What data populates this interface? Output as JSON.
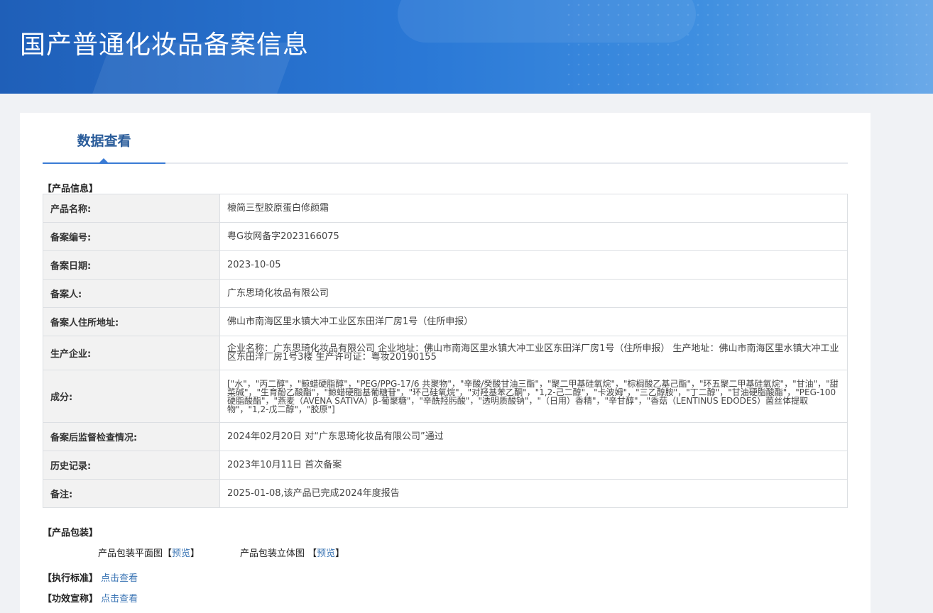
{
  "header": {
    "title": "国产普通化妆品备案信息"
  },
  "tab": {
    "label": "数据查看"
  },
  "product_section": {
    "title": "【产品信息】",
    "rows": [
      {
        "label": "产品名称:",
        "value": "榱简三型胶原蛋白修颜霜"
      },
      {
        "label": "备案编号:",
        "value": "粤G妆网备字2023166075"
      },
      {
        "label": "备案日期:",
        "value": "2023-10-05"
      },
      {
        "label": "备案人:",
        "value": "广东思琦化妆品有限公司"
      },
      {
        "label": "备案人住所地址:",
        "value": "佛山市南海区里水镇大冲工业区东田洋厂房1号（住所申报）"
      },
      {
        "label": "生产企业:",
        "value": "企业名称：广东思琦化妆品有限公司 企业地址：佛山市南海区里水镇大冲工业区东田洋厂房1号（住所申报） 生产地址：佛山市南海区里水镇大冲工业区东田洋厂房1号3楼 生产许可证：粤妆20190155"
      },
      {
        "label": "成分:",
        "value": "[\"水\"，\"丙二醇\"，\"鲸蜡硬脂醇\"，\"PEG/PPG-17/6 共聚物\"，\"辛酸/癸酸甘油三酯\"，\"聚二甲基硅氧烷\"，\"棕榈酸乙基己酯\"，\"环五聚二甲基硅氧烷\"，\"甘油\"，\"甜菜碱\"，\"生育酚乙酸酯\"，\"鲸蜡硬脂基葡糖苷\"，\"环己硅氧烷\"，\"对羟基苯乙酮\"，\"1,2-己二醇\"，\"卡波姆\"，\"三乙醇胺\"，\"丁二醇\"，\"甘油硬脂酸酯\"，\"PEG-100 硬脂酸酯\"，\"燕麦（AVENA SATIVA）β-葡聚糖\"，\"辛酰羟肟酸\"，\"透明质酸钠\"，\"（日用）香精\"，\"辛甘醇\"，\"香菇（LENTINUS EDODES）菌丝体提取物\"，\"1,2-戊二醇\"，\"胶原\"]"
      },
      {
        "label": "备案后监督检查情况:",
        "value": "2024年02月20日 对“广东思琦化妆品有限公司”通过"
      },
      {
        "label": "历史记录:",
        "value": "2023年10月11日 首次备案"
      },
      {
        "label": "备注:",
        "value": "2025-01-08,该产品已完成2024年度报告"
      }
    ]
  },
  "package_section": {
    "title": "【产品包装】",
    "flat_label": "产品包装平面图【",
    "flat_link": "预览",
    "flat_close": "】",
    "solid_label": "产品包装立体图 【",
    "solid_link": "预览",
    "solid_close": "】"
  },
  "standard_section": {
    "title": "【执行标准】",
    "link": "点击查看"
  },
  "efficacy_section": {
    "title": "【功效宣称】",
    "link": "点击查看"
  },
  "colors": {
    "banner": "#2a78d6",
    "tab_text": "#2a5c9a",
    "link": "#3a74b4"
  }
}
